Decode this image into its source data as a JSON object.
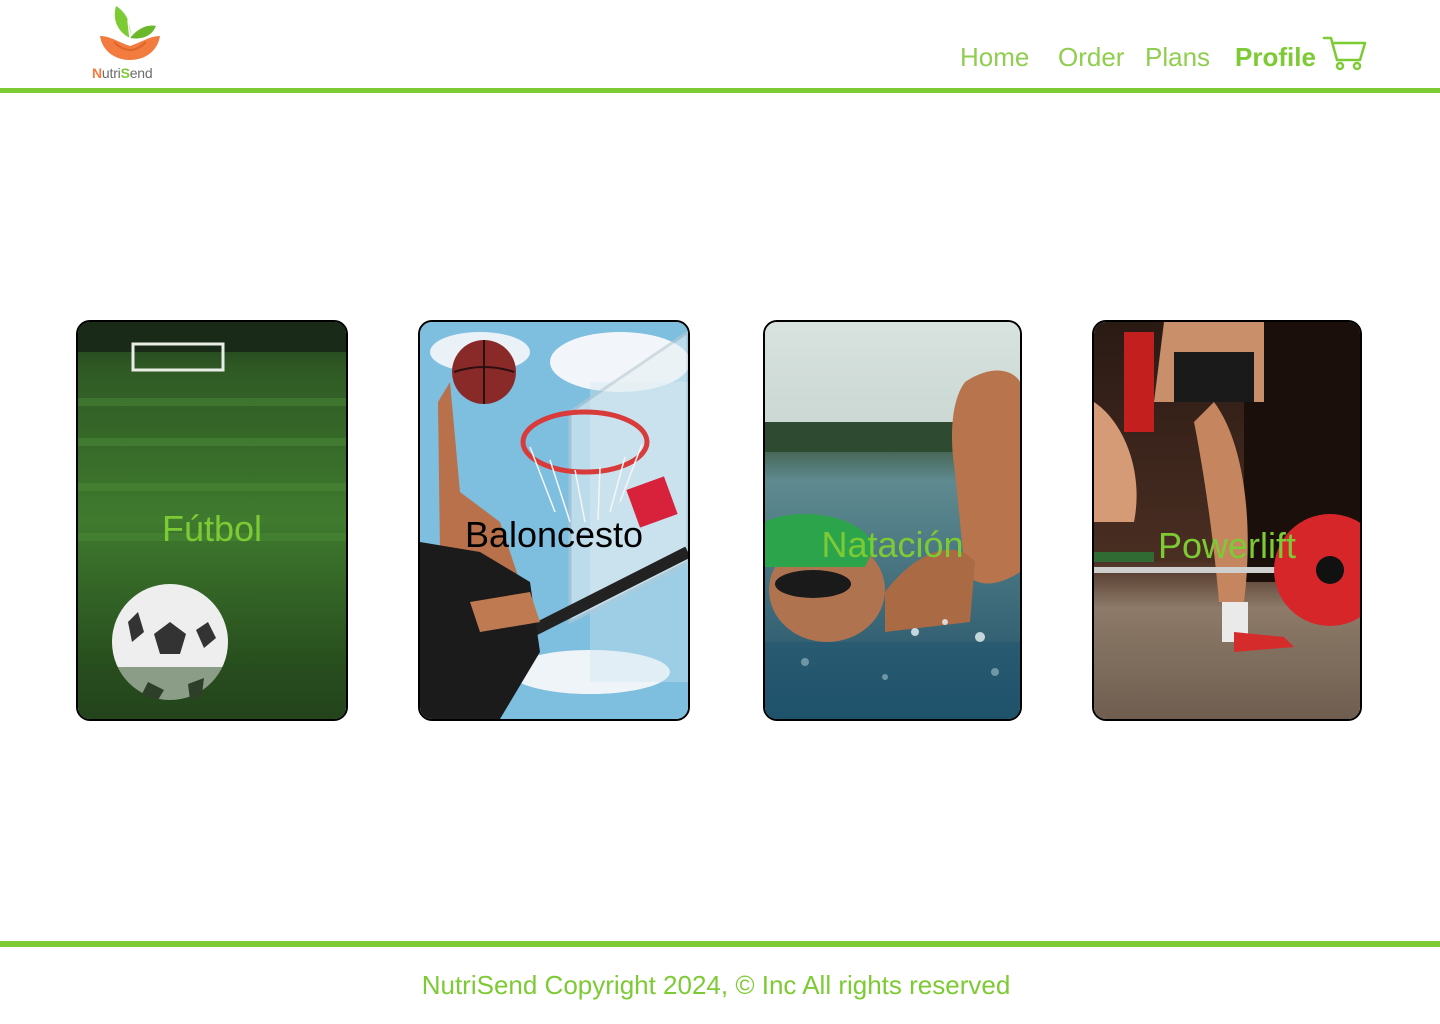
{
  "brand": {
    "name_n": "N",
    "name_utri": "utri",
    "name_s": "S",
    "name_end": "end"
  },
  "nav": {
    "home": "Home",
    "order": "Order",
    "plans": "Plans",
    "profile": "Profile"
  },
  "cards": [
    {
      "label": "Fútbol",
      "label_color": "#7dcb34"
    },
    {
      "label": "Baloncesto",
      "label_color": "#000000"
    },
    {
      "label": "Natación",
      "label_color": "#7dcb34"
    },
    {
      "label": "Powerlift",
      "label_color": "#7dcb34"
    }
  ],
  "footer": {
    "text": "NutriSend Copyright 2024, © Inc All rights reserved"
  },
  "colors": {
    "accent": "#7dcb34",
    "orange": "#f27c3f"
  },
  "icons": {
    "cart": "cart-icon",
    "logo": "leaf-bowl-logo"
  }
}
